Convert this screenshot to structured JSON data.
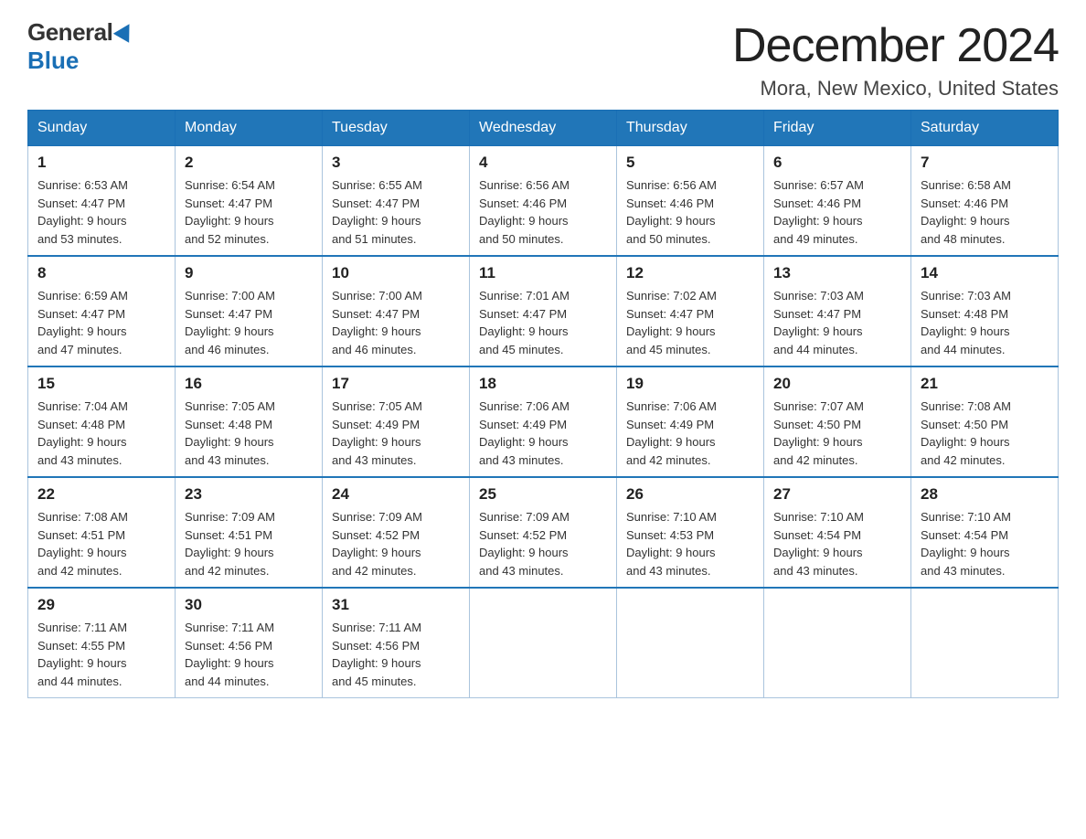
{
  "logo": {
    "general": "General",
    "blue": "Blue"
  },
  "title": {
    "month": "December 2024",
    "location": "Mora, New Mexico, United States"
  },
  "weekdays": [
    "Sunday",
    "Monday",
    "Tuesday",
    "Wednesday",
    "Thursday",
    "Friday",
    "Saturday"
  ],
  "weeks": [
    [
      {
        "day": "1",
        "sunrise": "6:53 AM",
        "sunset": "4:47 PM",
        "daylight": "9 hours and 53 minutes."
      },
      {
        "day": "2",
        "sunrise": "6:54 AM",
        "sunset": "4:47 PM",
        "daylight": "9 hours and 52 minutes."
      },
      {
        "day": "3",
        "sunrise": "6:55 AM",
        "sunset": "4:47 PM",
        "daylight": "9 hours and 51 minutes."
      },
      {
        "day": "4",
        "sunrise": "6:56 AM",
        "sunset": "4:46 PM",
        "daylight": "9 hours and 50 minutes."
      },
      {
        "day": "5",
        "sunrise": "6:56 AM",
        "sunset": "4:46 PM",
        "daylight": "9 hours and 50 minutes."
      },
      {
        "day": "6",
        "sunrise": "6:57 AM",
        "sunset": "4:46 PM",
        "daylight": "9 hours and 49 minutes."
      },
      {
        "day": "7",
        "sunrise": "6:58 AM",
        "sunset": "4:46 PM",
        "daylight": "9 hours and 48 minutes."
      }
    ],
    [
      {
        "day": "8",
        "sunrise": "6:59 AM",
        "sunset": "4:47 PM",
        "daylight": "9 hours and 47 minutes."
      },
      {
        "day": "9",
        "sunrise": "7:00 AM",
        "sunset": "4:47 PM",
        "daylight": "9 hours and 46 minutes."
      },
      {
        "day": "10",
        "sunrise": "7:00 AM",
        "sunset": "4:47 PM",
        "daylight": "9 hours and 46 minutes."
      },
      {
        "day": "11",
        "sunrise": "7:01 AM",
        "sunset": "4:47 PM",
        "daylight": "9 hours and 45 minutes."
      },
      {
        "day": "12",
        "sunrise": "7:02 AM",
        "sunset": "4:47 PM",
        "daylight": "9 hours and 45 minutes."
      },
      {
        "day": "13",
        "sunrise": "7:03 AM",
        "sunset": "4:47 PM",
        "daylight": "9 hours and 44 minutes."
      },
      {
        "day": "14",
        "sunrise": "7:03 AM",
        "sunset": "4:48 PM",
        "daylight": "9 hours and 44 minutes."
      }
    ],
    [
      {
        "day": "15",
        "sunrise": "7:04 AM",
        "sunset": "4:48 PM",
        "daylight": "9 hours and 43 minutes."
      },
      {
        "day": "16",
        "sunrise": "7:05 AM",
        "sunset": "4:48 PM",
        "daylight": "9 hours and 43 minutes."
      },
      {
        "day": "17",
        "sunrise": "7:05 AM",
        "sunset": "4:49 PM",
        "daylight": "9 hours and 43 minutes."
      },
      {
        "day": "18",
        "sunrise": "7:06 AM",
        "sunset": "4:49 PM",
        "daylight": "9 hours and 43 minutes."
      },
      {
        "day": "19",
        "sunrise": "7:06 AM",
        "sunset": "4:49 PM",
        "daylight": "9 hours and 42 minutes."
      },
      {
        "day": "20",
        "sunrise": "7:07 AM",
        "sunset": "4:50 PM",
        "daylight": "9 hours and 42 minutes."
      },
      {
        "day": "21",
        "sunrise": "7:08 AM",
        "sunset": "4:50 PM",
        "daylight": "9 hours and 42 minutes."
      }
    ],
    [
      {
        "day": "22",
        "sunrise": "7:08 AM",
        "sunset": "4:51 PM",
        "daylight": "9 hours and 42 minutes."
      },
      {
        "day": "23",
        "sunrise": "7:09 AM",
        "sunset": "4:51 PM",
        "daylight": "9 hours and 42 minutes."
      },
      {
        "day": "24",
        "sunrise": "7:09 AM",
        "sunset": "4:52 PM",
        "daylight": "9 hours and 42 minutes."
      },
      {
        "day": "25",
        "sunrise": "7:09 AM",
        "sunset": "4:52 PM",
        "daylight": "9 hours and 43 minutes."
      },
      {
        "day": "26",
        "sunrise": "7:10 AM",
        "sunset": "4:53 PM",
        "daylight": "9 hours and 43 minutes."
      },
      {
        "day": "27",
        "sunrise": "7:10 AM",
        "sunset": "4:54 PM",
        "daylight": "9 hours and 43 minutes."
      },
      {
        "day": "28",
        "sunrise": "7:10 AM",
        "sunset": "4:54 PM",
        "daylight": "9 hours and 43 minutes."
      }
    ],
    [
      {
        "day": "29",
        "sunrise": "7:11 AM",
        "sunset": "4:55 PM",
        "daylight": "9 hours and 44 minutes."
      },
      {
        "day": "30",
        "sunrise": "7:11 AM",
        "sunset": "4:56 PM",
        "daylight": "9 hours and 44 minutes."
      },
      {
        "day": "31",
        "sunrise": "7:11 AM",
        "sunset": "4:56 PM",
        "daylight": "9 hours and 45 minutes."
      },
      null,
      null,
      null,
      null
    ]
  ],
  "labels": {
    "sunrise": "Sunrise:",
    "sunset": "Sunset:",
    "daylight": "Daylight:"
  }
}
